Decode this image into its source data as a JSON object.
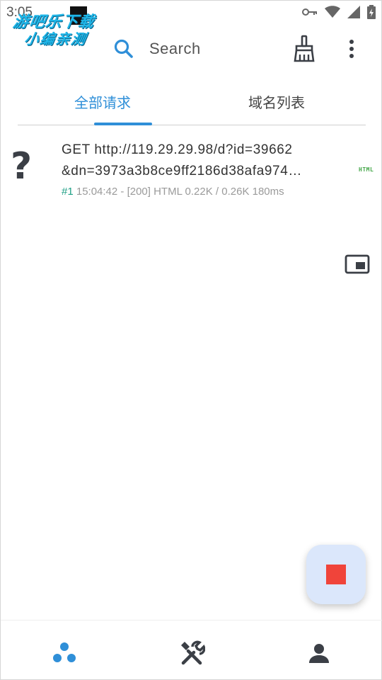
{
  "status_bar": {
    "time": "3:05",
    "icons": [
      "vpn-key-icon",
      "wifi-icon",
      "signal-icon",
      "battery-charging-icon"
    ]
  },
  "watermark": {
    "line1": "游吧乐下载",
    "line2": "小编亲测"
  },
  "toolbar": {
    "search_label": "Search",
    "icons": [
      "search-icon",
      "broom-icon",
      "more-vert-icon"
    ]
  },
  "tabs": [
    {
      "label": "全部请求",
      "active": true
    },
    {
      "label": "域名列表",
      "active": false
    }
  ],
  "requests": [
    {
      "icon": "question-mark",
      "line1": "GET http://119.29.29.98/d?id=39662",
      "line2": "&dn=3973a3b8ce9ff2186d38afa974…",
      "number": "#1",
      "meta": " 15:04:42 - [200] HTML 0.22K / 0.26K  180ms",
      "type_badge": "HTML"
    }
  ],
  "fab": {
    "icon": "stop-icon"
  },
  "bottom_nav": {
    "items": [
      "home-dots-icon",
      "tools-icon",
      "profile-icon"
    ]
  },
  "colors": {
    "accent": "#2f8fd8",
    "stop": "#f0443a",
    "fab_bg": "#dbe7fb",
    "request_number": "#1fa086",
    "html_badge": "#46a84b"
  }
}
